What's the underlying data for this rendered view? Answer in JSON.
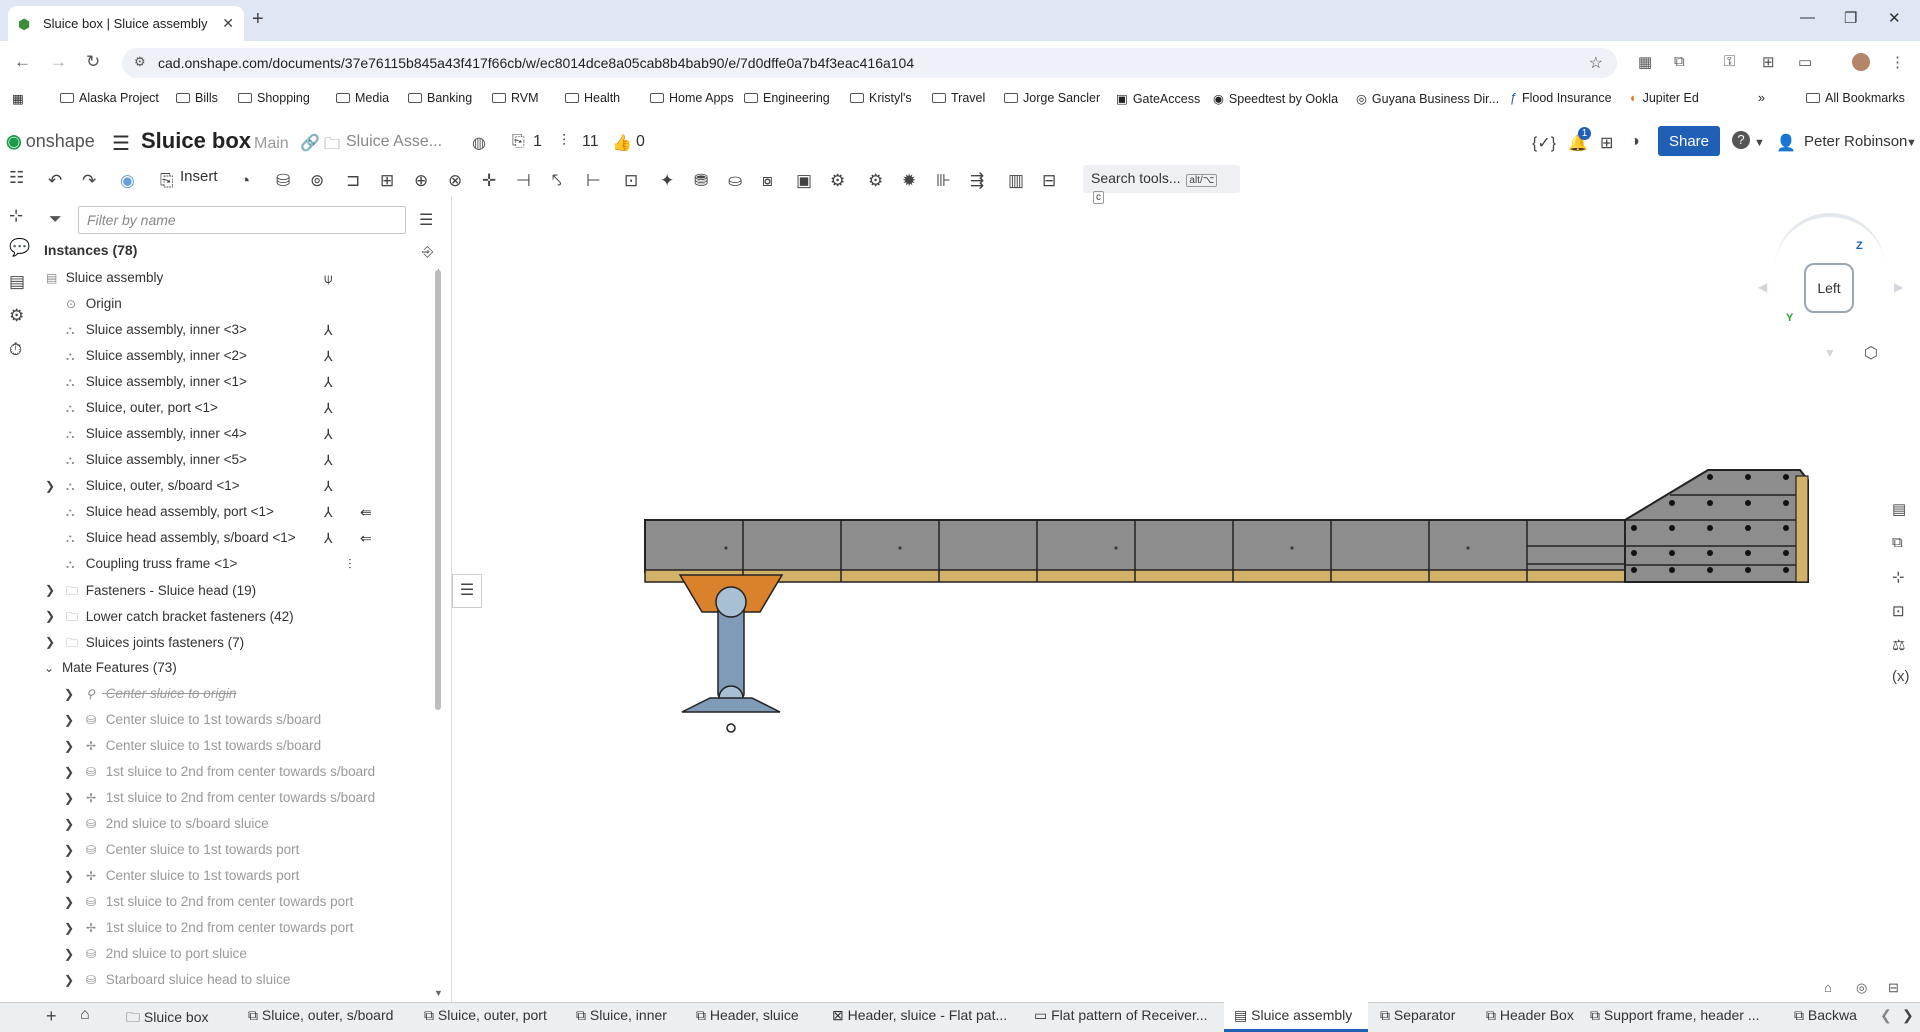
{
  "browser": {
    "tab_title": "Sluice box | Sluice assembly",
    "url": "cad.onshape.com/documents/37e76115b845a43f417f66cb/w/ec8014dce8a05cab8b4bab90/e/7d0dffe0a7b4f3eac416a104",
    "bookmarks": [
      "Alaska Project",
      "Bills",
      "Shopping",
      "Media",
      "Banking",
      "RVM",
      "Health",
      "Home Apps",
      "Engineering",
      "Kristyl's",
      "Travel",
      "Jorge Sancler",
      "GateAccess",
      "Speedtest by Ookla",
      "Guyana Business Dir...",
      "Flood Insurance",
      "Jupiter Ed"
    ],
    "all_bookmarks": "All Bookmarks",
    "overflow": "»"
  },
  "header": {
    "brand": "onshape",
    "doc_title": "Sluice box",
    "branch": "Main",
    "breadcrumb": "Sluice Asse...",
    "versions_count": "1",
    "branches_count": "11",
    "likes_count": "0",
    "notifications_count": "1",
    "share_label": "Share",
    "help_label": "?",
    "user_name": "Peter Robinson"
  },
  "toolbar": {
    "insert_label": "Insert",
    "search_tools": "Search tools...",
    "search_key": "alt/⌥",
    "search_key2": "c"
  },
  "panel": {
    "filter_placeholder": "Filter by name",
    "instances_title": "Instances (78)",
    "items": [
      {
        "label": "Sluice assembly"
      },
      {
        "label": "Origin"
      },
      {
        "label": "Sluice assembly, inner <3>"
      },
      {
        "label": "Sluice assembly, inner <2>"
      },
      {
        "label": "Sluice assembly, inner <1>"
      },
      {
        "label": "Sluice, outer, port <1>"
      },
      {
        "label": "Sluice assembly, inner <4>"
      },
      {
        "label": "Sluice assembly, inner <5>"
      },
      {
        "label": "Sluice, outer, s/board <1>"
      },
      {
        "label": "Sluice head assembly, port <1>"
      },
      {
        "label": "Sluice head assembly, s/board <1>"
      },
      {
        "label": "Coupling truss frame <1>"
      },
      {
        "label": "Fasteners - Sluice head (19)"
      },
      {
        "label": "Lower catch bracket fasteners (42)"
      },
      {
        "label": "Sluices joints fasteners (7)"
      },
      {
        "label": "Mate Features (73)"
      }
    ],
    "mates": [
      "Center sluice to origin",
      "Center sluice to 1st towards s/board",
      "Center sluice to 1st towards s/board",
      "1st sluice to 2nd from center towards s/board",
      "1st sluice to 2nd from center towards s/board",
      "2nd sluice to s/board sluice",
      "Center sluice to 1st towards port",
      "Center sluice to 1st towards port",
      "1st sluice to 2nd from center towards port",
      "1st sluice to 2nd from center towards port",
      "2nd sluice to port sluice",
      "Starboard sluice head to sluice"
    ]
  },
  "viewcube": {
    "face": "Left",
    "axis_z": "Z",
    "axis_y": "Y"
  },
  "bottom_tabs": [
    "Sluice box",
    "Sluice, outer, s/board",
    "Sluice, outer, port",
    "Sluice, inner",
    "Header, sluice",
    "Header, sluice - Flat pat...",
    "Flat pattern of Receiver...",
    "Sluice assembly",
    "Separator",
    "Header Box",
    "Support frame, header ...",
    "Backwa"
  ],
  "colors": {
    "accent": "#1f5fb6",
    "brand": "#1a9c4a",
    "steel": "#8d8d8d",
    "wood": "#d2b169",
    "bracket": "#d9822b",
    "support": "#7f9bb8"
  }
}
